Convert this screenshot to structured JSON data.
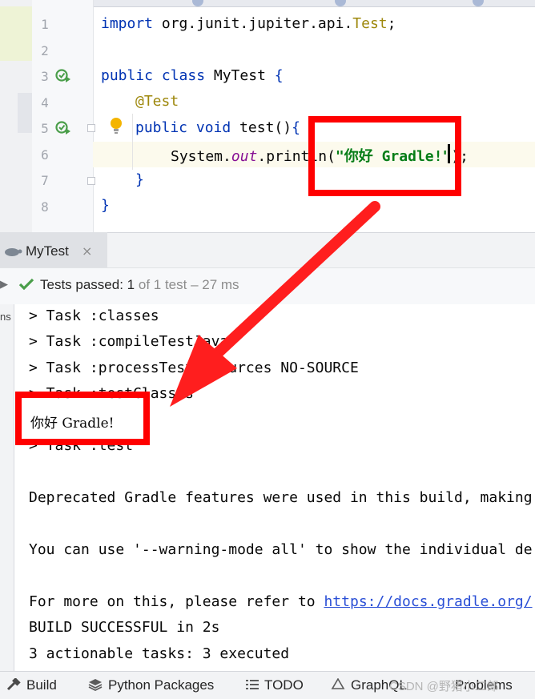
{
  "editor": {
    "line_numbers": [
      "1",
      "2",
      "3",
      "4",
      "5",
      "6",
      "7",
      "8"
    ],
    "lines": {
      "l1_kw": "import",
      "l1_pkg": " org.junit.jupiter.api.",
      "l1_type": "Test",
      "l1_end": ";",
      "l3_kw": "public class",
      "l3_name": " MyTest ",
      "l3_brace": "{",
      "l4_ann": "@Test",
      "l5_kw": "public void",
      "l5_name": " test()",
      "l5_brace": "{",
      "l6_a": "System.",
      "l6_out": "out",
      "l6_b": ".println(",
      "l6_str": "\"你好 Gradle!\"",
      "l6_end": ");",
      "l7_brace": "}",
      "l8_brace": "}"
    }
  },
  "tool_window": {
    "tab_title": "MyTest",
    "close_glyph": "×",
    "status_passed": "Tests passed: ",
    "status_count": "1",
    "status_rest": " of 1 test – 27 ms",
    "side_label": "ns",
    "left_glyph": "▶"
  },
  "console": {
    "lines": [
      "> Task :classes",
      "> Task :compileTestJava",
      "> Task :processTestResources NO-SOURCE",
      "> Task :testClasses",
      "你好 Gradle!",
      "> Task :test",
      "",
      "Deprecated Gradle features were used in this build, making",
      "",
      "You can use '--warning-mode all' to show the individual de",
      "",
      "For more on this, please refer to ",
      "BUILD SUCCESSFUL in 2s",
      "3 actionable tasks: 3 executed"
    ],
    "link_text": "https://docs.gradle.org/"
  },
  "bottom_bar": {
    "items": [
      "Build",
      "Python Packages",
      "TODO",
      "GraphQL",
      "Problems"
    ],
    "watermark": "CSDN @野猪小二郎"
  },
  "colors": {
    "keyword": "#0033b3",
    "string": "#067d17",
    "annotation": "#9e880d",
    "field": "#871094",
    "annotation_box": "#ff0000",
    "success_check": "#4a9e4a"
  }
}
